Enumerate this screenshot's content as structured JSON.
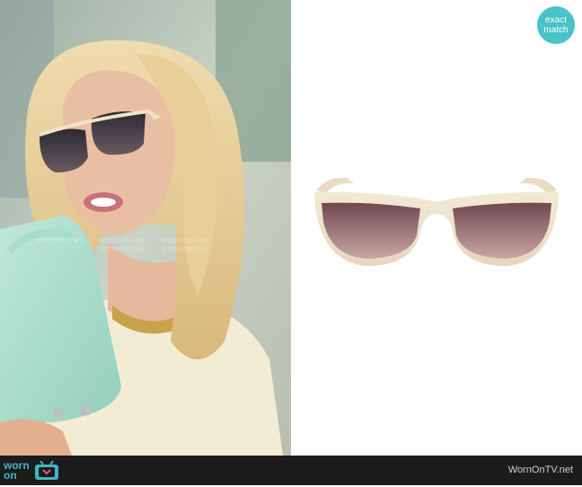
{
  "badge": {
    "line1": "exact",
    "line2": "match"
  },
  "footer": {
    "logo_worn": "worn",
    "logo_on": "on",
    "site": "WornOnTV.net"
  },
  "watermarks": [
    "wornontv.net",
    "wornontv.net",
    "wornontv.net",
    "wornontv.net",
    "wornontv.net"
  ],
  "colors": {
    "accent": "#49c2c9",
    "footer_bg": "#1c1c1c"
  }
}
